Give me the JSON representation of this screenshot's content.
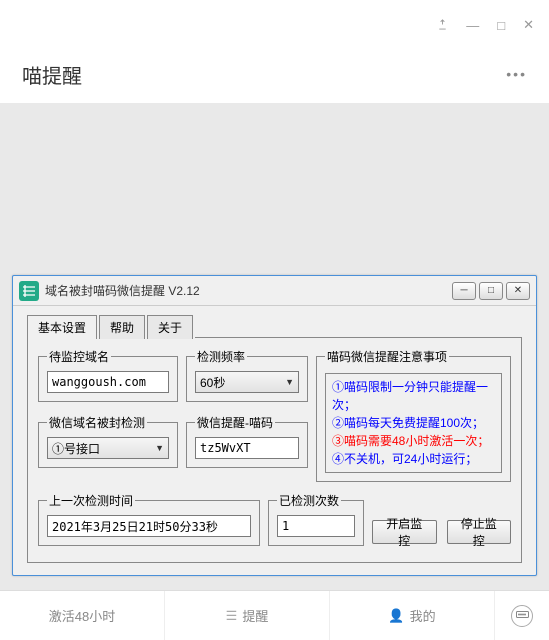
{
  "outer": {
    "title": "喵提醒",
    "more": "•••"
  },
  "inner_window": {
    "title": "域名被封喵码微信提醒 V2.12"
  },
  "tabs": {
    "basic": "基本设置",
    "help": "帮助",
    "about": "关于"
  },
  "groups": {
    "domain": {
      "legend": "待监控域名",
      "value": "wanggoush.com"
    },
    "freq": {
      "legend": "检测频率",
      "value": "60秒"
    },
    "check": {
      "legend": "微信域名被封检测",
      "value": "①号接口"
    },
    "wxremind": {
      "legend": "微信提醒-喵码",
      "value": "tz5WvXT"
    },
    "notice": {
      "legend": "喵码微信提醒注意事项",
      "lines": [
        "①喵码限制一分钟只能提醒一次；",
        "②喵码每天免费提醒100次；",
        "③喵码需要48小时激活一次；",
        "④不关机，可24小时运行；"
      ]
    },
    "lasttime": {
      "legend": "上一次检测时间",
      "value": "2021年3月25日21时50分33秒"
    },
    "count": {
      "legend": "已检测次数",
      "value": "1"
    }
  },
  "buttons": {
    "start": "开启监控",
    "stop": "停止监控"
  },
  "footer": {
    "activate": "激活48小时",
    "remind": "提醒",
    "mine": "我的"
  }
}
